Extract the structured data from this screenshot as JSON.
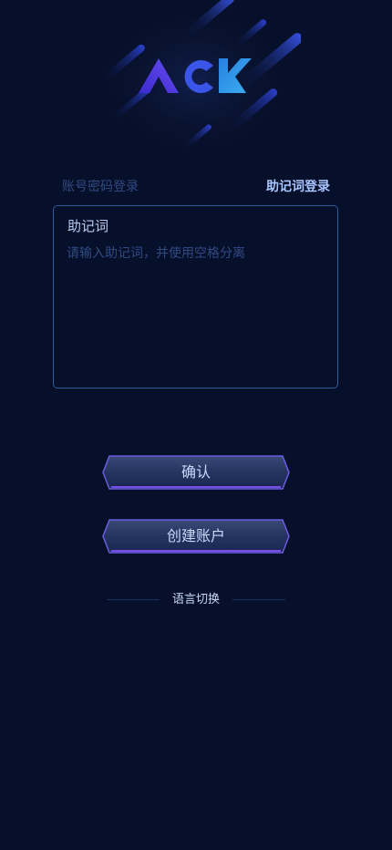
{
  "logo": {
    "text": "ACK",
    "icon": "ack-logo"
  },
  "login_tabs": {
    "password_label": "账号密码登录",
    "mnemonic_label": "助记词登录",
    "active": "mnemonic"
  },
  "mnemonic": {
    "label": "助记词",
    "value": "",
    "placeholder": "请输入助记词，并使用空格分离"
  },
  "buttons": {
    "confirm_label": "确认",
    "create_account_label": "创建账户"
  },
  "language_switch": {
    "label": "语言切换"
  },
  "colors": {
    "background": "#07102a",
    "accent": "#a9c5ff",
    "border": "#2f5aa0",
    "muted": "#2f4a83",
    "button_glow": "#6a4cd6"
  }
}
